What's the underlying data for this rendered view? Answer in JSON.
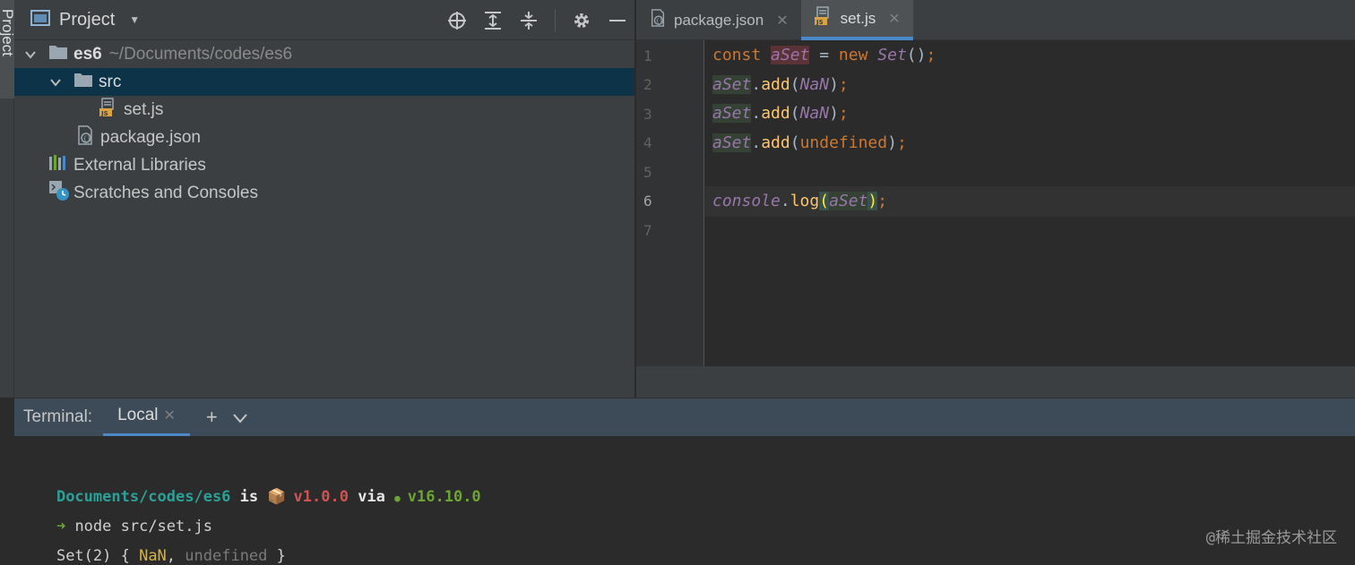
{
  "side_tab": {
    "label": "Project"
  },
  "project": {
    "title": "Project",
    "tree": {
      "root_name": "es6",
      "root_path": "~/Documents/codes/es6",
      "src": "src",
      "setjs": "set.js",
      "package": "package.json",
      "ext_libs": "External Libraries",
      "scratches": "Scratches and Consoles"
    }
  },
  "editor": {
    "tabs": [
      {
        "label": "package.json"
      },
      {
        "label": "set.js"
      }
    ],
    "line_numbers": [
      "1",
      "2",
      "3",
      "4",
      "5",
      "6",
      "7"
    ],
    "code": {
      "l1": {
        "kw_const": "const",
        "var": "aSet",
        "eq": " = ",
        "kw_new": "new",
        "cls": "Set",
        "paren": "()",
        "semi": ";"
      },
      "l2": {
        "var": "aSet",
        "dot": ".",
        "fn": "add",
        "open": "(",
        "arg": "NaN",
        "close": ")",
        "semi": ";"
      },
      "l3": {
        "var": "aSet",
        "dot": ".",
        "fn": "add",
        "open": "(",
        "arg": "NaN",
        "close": ")",
        "semi": ";"
      },
      "l4": {
        "var": "aSet",
        "dot": ".",
        "fn": "add",
        "open": "(",
        "arg": "undefined",
        "close": ")",
        "semi": ";"
      },
      "l6": {
        "obj": "console",
        "dot": ".",
        "fn": "log",
        "open": "(",
        "arg": "aSet",
        "close": ")",
        "semi": ";"
      }
    }
  },
  "terminal": {
    "label": "Terminal:",
    "tab": "Local",
    "prompt": {
      "path": "Documents/codes/es6",
      "is": " is ",
      "pkg_icon": "📦",
      "version": "v1.0.0",
      "via": " via ",
      "node_icon": "●",
      "node_version": "v16.10.0"
    },
    "command": {
      "arrow": "➜",
      "text": " node src/set.js"
    },
    "output": {
      "prefix": "Set(2) { ",
      "nan": "NaN",
      "sep": ", ",
      "undef": "undefined",
      "suffix": " }"
    }
  },
  "watermark": "@稀土掘金技术社区"
}
